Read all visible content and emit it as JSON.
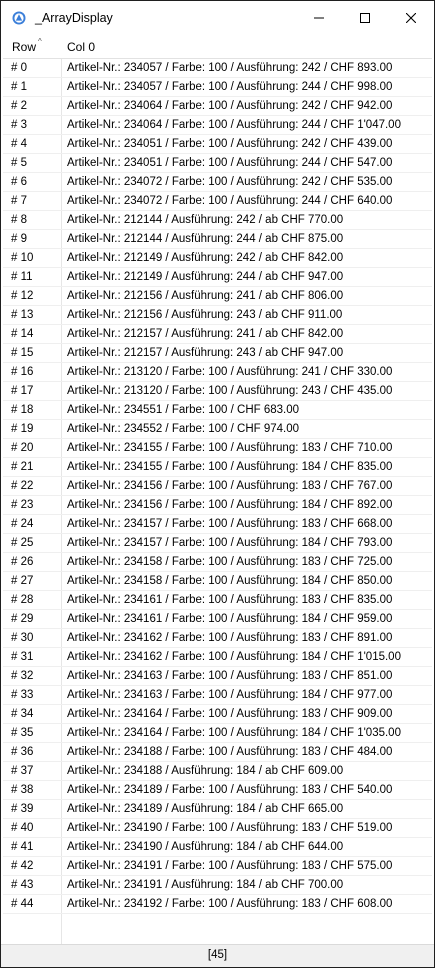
{
  "window": {
    "title": "_ArrayDisplay"
  },
  "header": {
    "row_label": "Row",
    "col_label": "Col 0"
  },
  "rows": [
    {
      "row": "# 0",
      "value": "Artikel-Nr.: 234057 / Farbe: 100 / Ausführung: 242 / CHF 893.00"
    },
    {
      "row": "# 1",
      "value": "Artikel-Nr.: 234057 / Farbe: 100 / Ausführung: 244 / CHF 998.00"
    },
    {
      "row": "# 2",
      "value": "Artikel-Nr.: 234064 / Farbe: 100 / Ausführung: 242 / CHF 942.00"
    },
    {
      "row": "# 3",
      "value": "Artikel-Nr.: 234064 / Farbe: 100 / Ausführung: 244 / CHF 1'047.00"
    },
    {
      "row": "# 4",
      "value": "Artikel-Nr.: 234051 / Farbe: 100 / Ausführung: 242 / CHF 439.00"
    },
    {
      "row": "# 5",
      "value": "Artikel-Nr.: 234051 / Farbe: 100 / Ausführung: 244 / CHF 547.00"
    },
    {
      "row": "# 6",
      "value": "Artikel-Nr.: 234072 / Farbe: 100 / Ausführung: 242 / CHF 535.00"
    },
    {
      "row": "# 7",
      "value": "Artikel-Nr.: 234072 / Farbe: 100 / Ausführung: 244 / CHF 640.00"
    },
    {
      "row": "# 8",
      "value": "Artikel-Nr.: 212144 / Ausführung: 242 / ab CHF 770.00"
    },
    {
      "row": "# 9",
      "value": "Artikel-Nr.: 212144 / Ausführung: 244 / ab CHF 875.00"
    },
    {
      "row": "# 10",
      "value": "Artikel-Nr.: 212149 / Ausführung: 242 / ab CHF 842.00"
    },
    {
      "row": "# 11",
      "value": "Artikel-Nr.: 212149 / Ausführung: 244 / ab CHF 947.00"
    },
    {
      "row": "# 12",
      "value": "Artikel-Nr.: 212156 / Ausführung: 241 / ab CHF 806.00"
    },
    {
      "row": "# 13",
      "value": "Artikel-Nr.: 212156 / Ausführung: 243 / ab CHF 911.00"
    },
    {
      "row": "# 14",
      "value": "Artikel-Nr.: 212157 / Ausführung: 241 / ab CHF 842.00"
    },
    {
      "row": "# 15",
      "value": "Artikel-Nr.: 212157 / Ausführung: 243 / ab CHF 947.00"
    },
    {
      "row": "# 16",
      "value": "Artikel-Nr.: 213120 / Farbe: 100 / Ausführung: 241 / CHF 330.00"
    },
    {
      "row": "# 17",
      "value": "Artikel-Nr.: 213120 / Farbe: 100 / Ausführung: 243 / CHF 435.00"
    },
    {
      "row": "# 18",
      "value": "Artikel-Nr.: 234551 / Farbe: 100 / CHF 683.00"
    },
    {
      "row": "# 19",
      "value": "Artikel-Nr.: 234552 / Farbe: 100 / CHF 974.00"
    },
    {
      "row": "# 20",
      "value": "Artikel-Nr.: 234155 / Farbe: 100 / Ausführung: 183 / CHF 710.00"
    },
    {
      "row": "# 21",
      "value": "Artikel-Nr.: 234155 / Farbe: 100 / Ausführung: 184 / CHF 835.00"
    },
    {
      "row": "# 22",
      "value": "Artikel-Nr.: 234156 / Farbe: 100 / Ausführung: 183 / CHF 767.00"
    },
    {
      "row": "# 23",
      "value": "Artikel-Nr.: 234156 / Farbe: 100 / Ausführung: 184 / CHF 892.00"
    },
    {
      "row": "# 24",
      "value": "Artikel-Nr.: 234157 / Farbe: 100 / Ausführung: 183 / CHF 668.00"
    },
    {
      "row": "# 25",
      "value": "Artikel-Nr.: 234157 / Farbe: 100 / Ausführung: 184 / CHF 793.00"
    },
    {
      "row": "# 26",
      "value": "Artikel-Nr.: 234158 / Farbe: 100 / Ausführung: 183 / CHF 725.00"
    },
    {
      "row": "# 27",
      "value": "Artikel-Nr.: 234158 / Farbe: 100 / Ausführung: 184 / CHF 850.00"
    },
    {
      "row": "# 28",
      "value": "Artikel-Nr.: 234161 / Farbe: 100 / Ausführung: 183 / CHF 835.00"
    },
    {
      "row": "# 29",
      "value": "Artikel-Nr.: 234161 / Farbe: 100 / Ausführung: 184 / CHF 959.00"
    },
    {
      "row": "# 30",
      "value": "Artikel-Nr.: 234162 / Farbe: 100 / Ausführung: 183 / CHF 891.00"
    },
    {
      "row": "# 31",
      "value": "Artikel-Nr.: 234162 / Farbe: 100 / Ausführung: 184 / CHF 1'015.00"
    },
    {
      "row": "# 32",
      "value": "Artikel-Nr.: 234163 / Farbe: 100 / Ausführung: 183 / CHF 851.00"
    },
    {
      "row": "# 33",
      "value": "Artikel-Nr.: 234163 / Farbe: 100 / Ausführung: 184 / CHF 977.00"
    },
    {
      "row": "# 34",
      "value": "Artikel-Nr.: 234164 / Farbe: 100 / Ausführung: 183 / CHF 909.00"
    },
    {
      "row": "# 35",
      "value": "Artikel-Nr.: 234164 / Farbe: 100 / Ausführung: 184 / CHF 1'035.00"
    },
    {
      "row": "# 36",
      "value": "Artikel-Nr.: 234188 / Farbe: 100 / Ausführung: 183 / CHF 484.00"
    },
    {
      "row": "# 37",
      "value": "Artikel-Nr.: 234188 / Ausführung: 184 / ab CHF 609.00"
    },
    {
      "row": "# 38",
      "value": "Artikel-Nr.: 234189 / Farbe: 100 / Ausführung: 183 / CHF 540.00"
    },
    {
      "row": "# 39",
      "value": "Artikel-Nr.: 234189 / Ausführung: 184 / ab CHF 665.00"
    },
    {
      "row": "# 40",
      "value": "Artikel-Nr.: 234190 / Farbe: 100 / Ausführung: 183 / CHF 519.00"
    },
    {
      "row": "# 41",
      "value": "Artikel-Nr.: 234190 / Ausführung: 184 / ab CHF 644.00"
    },
    {
      "row": "# 42",
      "value": "Artikel-Nr.: 234191 / Farbe: 100 / Ausführung: 183 / CHF 575.00"
    },
    {
      "row": "# 43",
      "value": "Artikel-Nr.: 234191 / Ausführung: 184 / ab CHF 700.00"
    },
    {
      "row": "# 44",
      "value": "Artikel-Nr.: 234192 / Farbe: 100 / Ausführung: 183 / CHF 608.00"
    }
  ],
  "status": {
    "text": "[45]"
  },
  "colors": {
    "app_icon": "#3b7fd9",
    "border": "#1f1f1f",
    "status_bg": "#f0f0f0"
  },
  "icons": {
    "app": "autoit-app-icon",
    "minimize": "minimize-icon",
    "maximize": "maximize-icon",
    "close": "close-icon"
  }
}
